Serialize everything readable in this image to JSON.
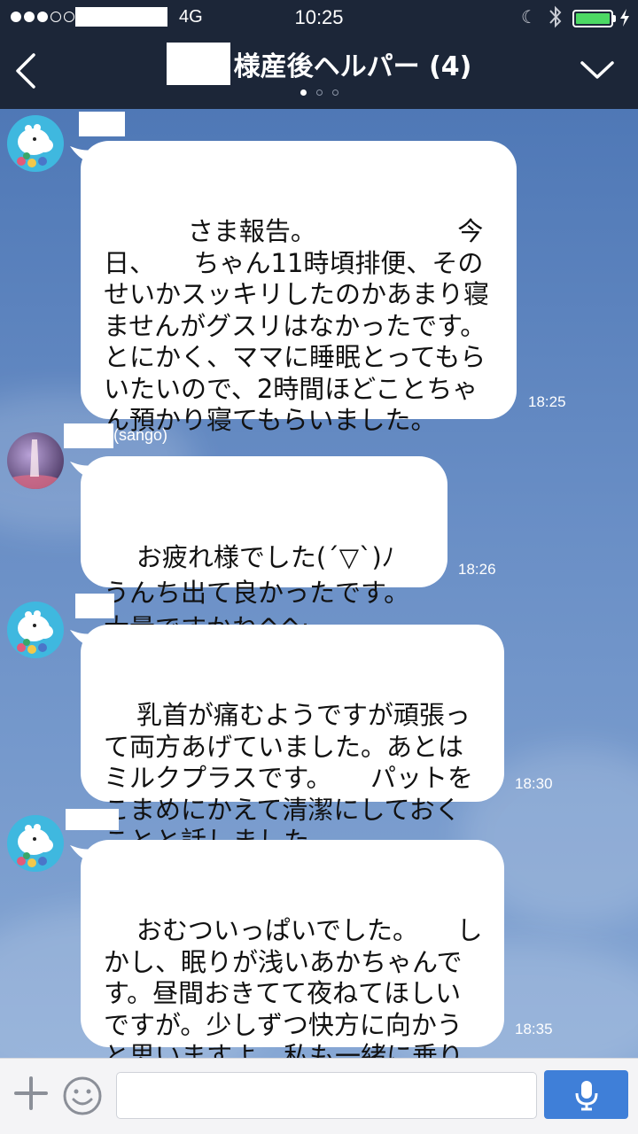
{
  "status_bar": {
    "network": "4G",
    "time": "10:25"
  },
  "header": {
    "title": "様産後ヘルパー (4)"
  },
  "messages": [
    {
      "sender": "",
      "text": "　　さま報告。　　　　　　今日、　　ちゃん11時頃排便、そのせいかスッキリしたのかあまり寝ませんがグスリはなかったです。　とにかく、ママに睡眠とってもらいたいので、2時間ほどことちゃん預かり寝てもらいました。",
      "time": "18:25"
    },
    {
      "sender": "(sango)",
      "text": "お疲れ様でした(´▽`)ﾉ\nうんち出て良かったです。\n大量ですかね^^;",
      "time": "18:26"
    },
    {
      "sender": "",
      "text": "乳首が痛むようですが頑張って両方あげていました。あとはミルクプラスです。　　パットをこまめにかえて清潔にしておくことと話しました。",
      "time": "18:30"
    },
    {
      "sender": "",
      "text": "おむついっぱいでした。　　しかし、眠りが浅いあかちゃんです。昼間おきてて夜ねてほしいですが。少しずつ快方に向かうと思いますよ。私も一緒に乗り越えます。",
      "time": "18:35"
    }
  ],
  "colors": {
    "bar": "#1c2638",
    "chat_bg": "#6f93c6",
    "mic_button": "#3f7fd8",
    "battery": "#4cd964"
  },
  "icons": [
    "back-chevron-icon",
    "menu-chevron-down-icon",
    "plus-icon",
    "emoji-icon",
    "microphone-icon",
    "bluetooth-icon",
    "moon-icon",
    "battery-icon"
  ]
}
